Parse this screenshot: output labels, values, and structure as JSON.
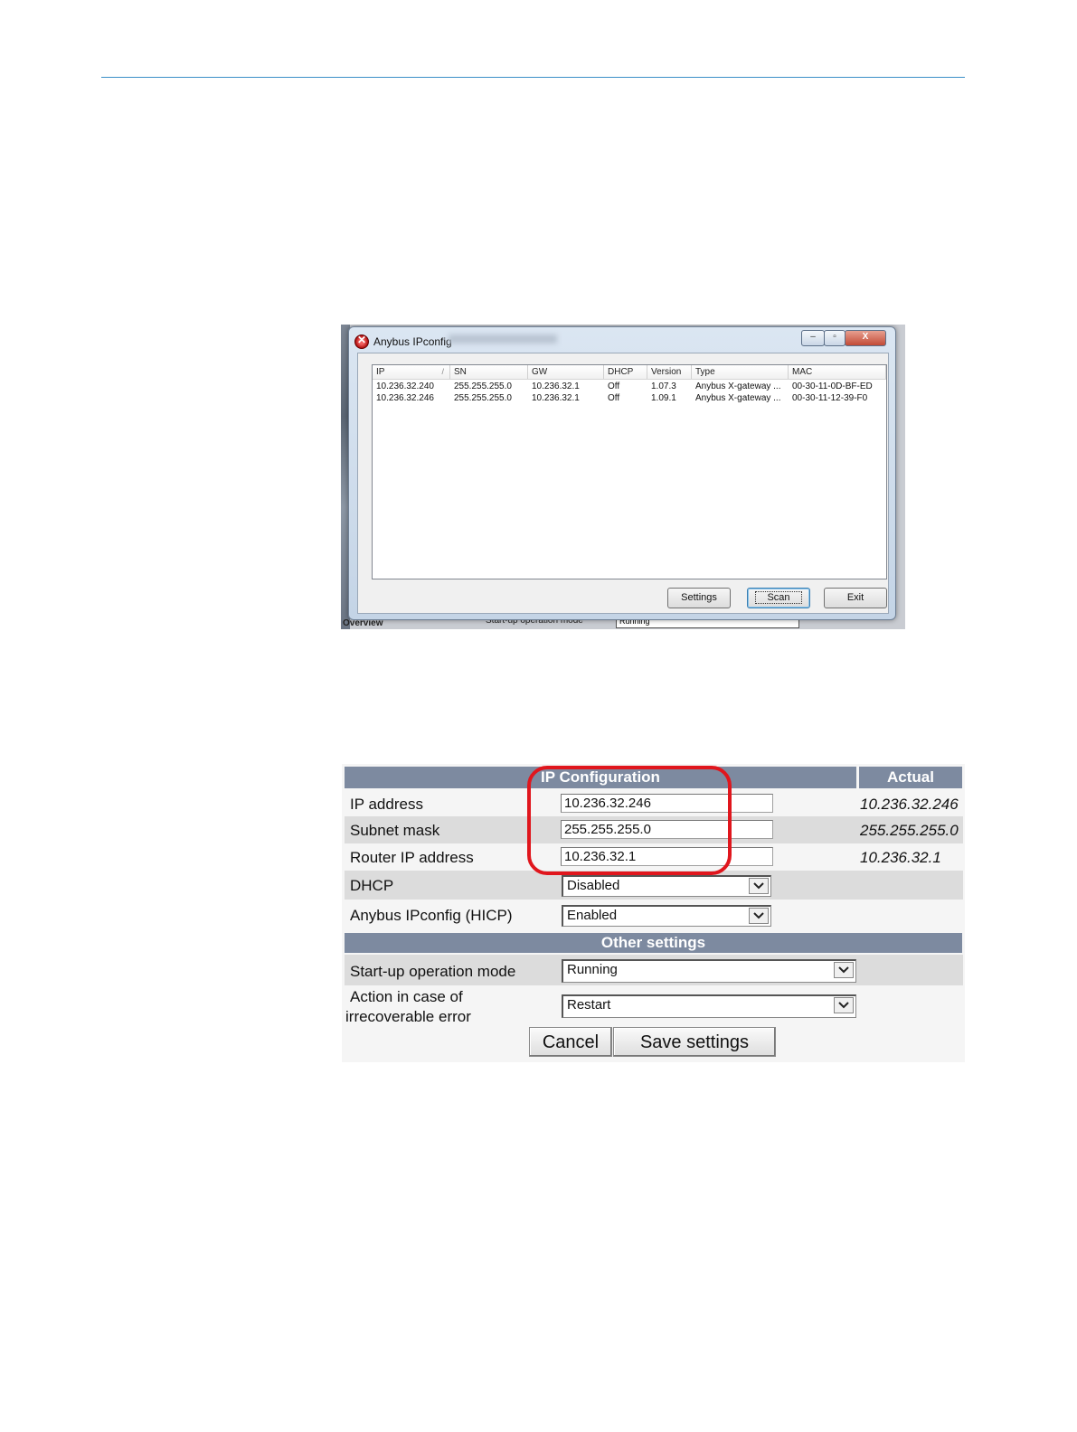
{
  "ipconfig_window": {
    "title": "Anybus IPconfig",
    "window_buttons": {
      "minimize": "–",
      "maximize": "▫",
      "close": "X"
    },
    "columns": [
      "IP",
      "SN",
      "GW",
      "DHCP",
      "Version",
      "Type",
      "MAC"
    ],
    "sort_indicator": "/",
    "rows": [
      [
        "10.236.32.240",
        "255.255.255.0",
        "10.236.32.1",
        "Off",
        "1.07.3",
        "Anybus X-gateway ...",
        "00-30-11-0D-BF-ED"
      ],
      [
        "10.236.32.246",
        "255.255.255.0",
        "10.236.32.1",
        "Off",
        "1.09.1",
        "Anybus X-gateway ...",
        "00-30-11-12-39-F0"
      ]
    ],
    "buttons": {
      "settings": "Settings",
      "scan": "Scan",
      "exit": "Exit"
    },
    "background": {
      "tab_label": "Overview",
      "startup_label": "Start-up operation mode",
      "startup_value": "Running"
    }
  },
  "web_config": {
    "header": {
      "ip_configuration": "IP Configuration",
      "actual": "Actual",
      "other_settings": "Other settings"
    },
    "ip_address": {
      "label": "IP address",
      "value": "10.236.32.246",
      "actual": "10.236.32.246"
    },
    "subnet_mask": {
      "label": "Subnet mask",
      "value": "255.255.255.0",
      "actual": "255.255.255.0"
    },
    "router_ip": {
      "label": "Router IP address",
      "value": "10.236.32.1",
      "actual": "10.236.32.1"
    },
    "dhcp": {
      "label": "DHCP",
      "value": "Disabled"
    },
    "hicp": {
      "label": "Anybus IPconfig (HICP)",
      "value": "Enabled"
    },
    "startup_mode": {
      "label": "Start-up operation mode",
      "value": "Running"
    },
    "irrecoverable": {
      "label_line1": "Action in case of",
      "label_line2": "irrecoverable error",
      "value": "Restart"
    },
    "buttons": {
      "cancel": "Cancel",
      "save": "Save settings"
    },
    "highlight_color": "#e0161d",
    "header_color": "#7d8aa0"
  }
}
